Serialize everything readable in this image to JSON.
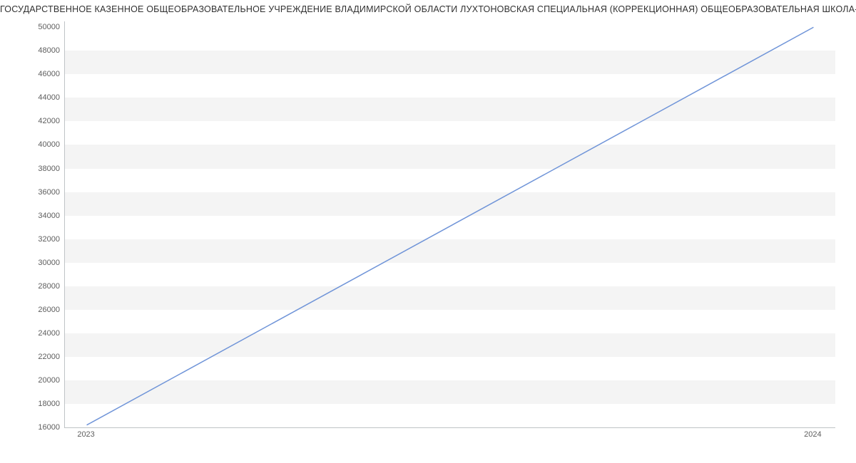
{
  "chart_data": {
    "type": "line",
    "title": "ГОСУДАРСТВЕННОЕ КАЗЕННОЕ ОБЩЕОБРАЗОВАТЕЛЬНОЕ УЧРЕЖДЕНИЕ ВЛАДИМИРСКОЙ ОБЛАСТИ ЛУХТОНОВСКАЯ СПЕЦИАЛЬНАЯ (КОРРЕКЦИОННАЯ) ОБЩЕОБРАЗОВАТЕЛЬНАЯ ШКОЛА-ИНТЕРНАТ",
    "x": [
      2023,
      2024
    ],
    "values": [
      16200,
      50000
    ],
    "xticks": [
      "2023",
      "2024"
    ],
    "yticks": [
      16000,
      18000,
      20000,
      22000,
      24000,
      26000,
      28000,
      30000,
      32000,
      34000,
      36000,
      38000,
      40000,
      42000,
      44000,
      46000,
      48000,
      50000
    ],
    "ylim": [
      16000,
      50500
    ],
    "xlim": [
      2022.97,
      2024.03
    ]
  }
}
